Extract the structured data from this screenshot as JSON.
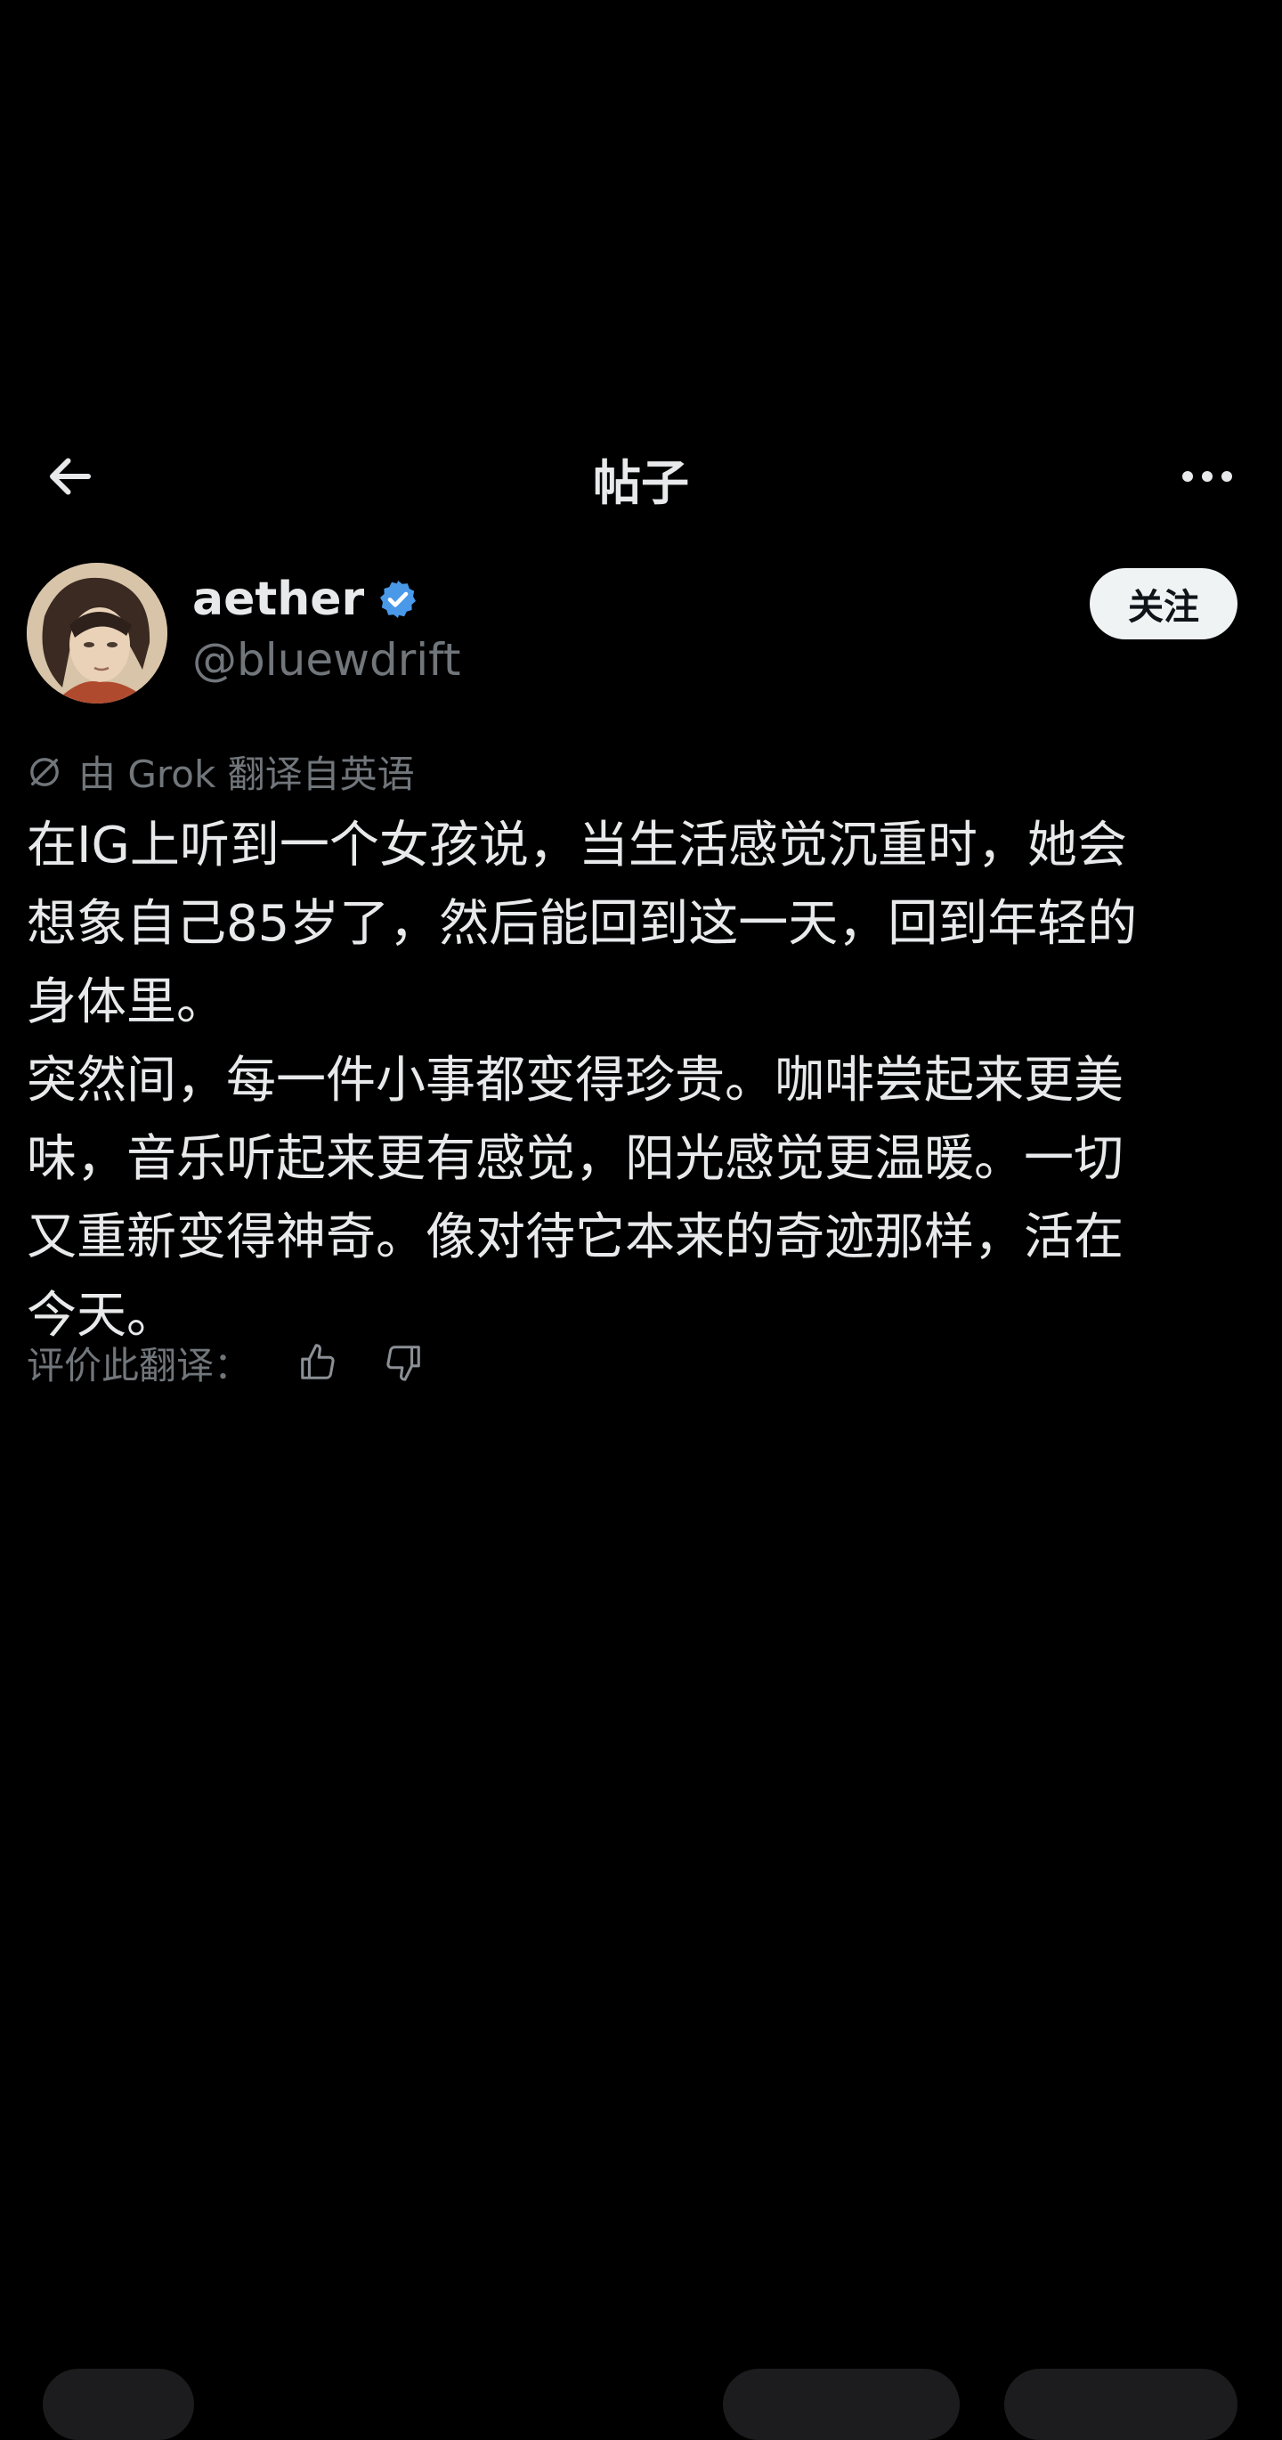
{
  "header": {
    "title": "帖子"
  },
  "author": {
    "display_name": "aether",
    "handle": "@bluewdrift",
    "follow_label": "关注",
    "verified_color": "#4a99e9"
  },
  "post": {
    "translation_note": "由 Grok 翻译自英语",
    "body": "在IG上听到一个女孩说，当生活感觉沉重时，她会\n想象自己85岁了，然后能回到这一天，回到年轻的\n身体里。\n突然间，每一件小事都变得珍贵。咖啡尝起来更美\n味，音乐听起来更有感觉，阳光感觉更温暖。一切\n又重新变得神奇。像对待它本来的奇迹那样，活在\n今天。",
    "rate_label": "评价此翻译："
  },
  "icons": {
    "back": "arrow-left-icon",
    "more": "more-horizontal-icon",
    "verified": "verified-badge-icon",
    "grok": "grok-icon",
    "thumbs_up": "thumbs-up-icon",
    "thumbs_down": "thumbs-down-icon"
  }
}
